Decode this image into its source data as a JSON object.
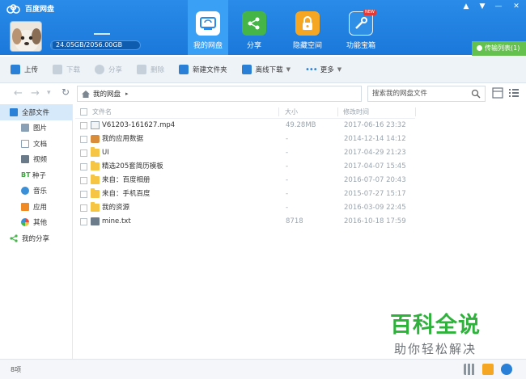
{
  "app": {
    "title": "百度网盘"
  },
  "account": {
    "quota_text": "24.05GB/2056.00GB",
    "quota_fraction": 0.0117
  },
  "nav_tabs": [
    {
      "label": "我的网盘",
      "icon": "cloud-drive-icon",
      "color": "#3aa0f6",
      "active": true
    },
    {
      "label": "分享",
      "icon": "share-icon",
      "color": "#45b548",
      "active": false
    },
    {
      "label": "隐藏空间",
      "icon": "lock-icon",
      "color": "#f5a623",
      "active": false
    },
    {
      "label": "功能宝箱",
      "icon": "toolbox-icon",
      "color": "#2f8fe6",
      "active": false,
      "badge": "NEW"
    }
  ],
  "window_controls": {
    "pin": "▲",
    "menu": "▼",
    "minimize": "—",
    "close": "✕"
  },
  "transfer": {
    "label": "传输列表(1)"
  },
  "toolbar": {
    "upload": "上传",
    "download": "下载",
    "share": "分享",
    "delete": "删除",
    "new_folder": "新建文件夹",
    "offline_download": "离线下载",
    "more": "更多"
  },
  "address": {
    "back": "←",
    "forward": "→",
    "history": "▾",
    "refresh": "↻",
    "breadcrumb": "我的网盘",
    "breadcrumb_arrow": "▸",
    "search_placeholder": "搜索我的网盘文件"
  },
  "sidebar": [
    {
      "label": "全部文件",
      "icon": "all-files-icon",
      "level": "top",
      "active": true
    },
    {
      "label": "图片",
      "icon": "image-icon",
      "level": "sub"
    },
    {
      "label": "文档",
      "icon": "document-icon",
      "level": "sub"
    },
    {
      "label": "视频",
      "icon": "video-icon",
      "level": "sub"
    },
    {
      "label": "种子",
      "icon": "torrent-icon",
      "level": "sub",
      "prefix": "BT"
    },
    {
      "label": "音乐",
      "icon": "music-icon",
      "level": "sub"
    },
    {
      "label": "应用",
      "icon": "app-icon",
      "level": "sub"
    },
    {
      "label": "其他",
      "icon": "other-icon",
      "level": "sub"
    },
    {
      "label": "我的分享",
      "icon": "share-icon",
      "level": "top"
    }
  ],
  "columns": {
    "name": "文件名",
    "size": "大小",
    "date": "修改时间"
  },
  "files": [
    {
      "name": "V61203-161627.mp4",
      "size": "49.28MB",
      "date": "2017-06-16 23:32",
      "type": "video"
    },
    {
      "name": "我的应用数据",
      "size": "-",
      "date": "2014-12-14 14:12",
      "type": "app-folder"
    },
    {
      "name": "UI",
      "size": "-",
      "date": "2017-04-29 21:23",
      "type": "folder"
    },
    {
      "name": "精选205套简历模板",
      "size": "-",
      "date": "2017-04-07 15:45",
      "type": "folder"
    },
    {
      "name": "来自：百度相册",
      "size": "-",
      "date": "2016-07-07 20:43",
      "type": "folder"
    },
    {
      "name": "来自：手机百度",
      "size": "-",
      "date": "2015-07-27 15:17",
      "type": "folder"
    },
    {
      "name": "我的资源",
      "size": "-",
      "date": "2016-03-09 22:45",
      "type": "folder"
    },
    {
      "name": "mine.txt",
      "size": "8718",
      "date": "2016-10-18 17:59",
      "type": "text"
    }
  ],
  "watermark": {
    "title": "百科全说",
    "subtitle": "助你轻松解决"
  },
  "status": {
    "count_text": "8项"
  }
}
